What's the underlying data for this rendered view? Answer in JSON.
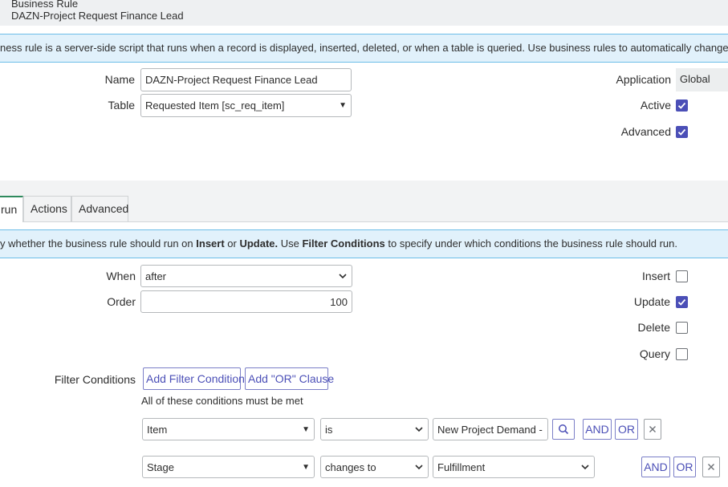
{
  "header": {
    "type_label": "Business Rule",
    "record_name": "DAZN-Project Request Finance Lead"
  },
  "info_banner": "ness rule is a server-side script that runs when a record is displayed, inserted, deleted, or when a table is queried. Use business rules to automatically change values in fo",
  "form": {
    "name_label": "Name",
    "name_value": "DAZN-Project Request Finance Lead",
    "table_label": "Table",
    "table_value": "Requested Item [sc_req_item]",
    "application_label": "Application",
    "application_value": "Global",
    "active_label": "Active",
    "active_checked": true,
    "advanced_label": "Advanced",
    "advanced_checked": true
  },
  "tabs": [
    {
      "label": "run",
      "active": true
    },
    {
      "label": "Actions",
      "active": false
    },
    {
      "label": "Advanced",
      "active": false
    }
  ],
  "when_banner": {
    "t1": "y whether the business rule should run on ",
    "b1": "Insert",
    "t2": " or ",
    "b2": "Update.",
    "t3": " Use ",
    "b3": "Filter Conditions",
    "t4": " to specify under which conditions the business rule should run."
  },
  "when": {
    "when_label": "When",
    "when_value": "after",
    "order_label": "Order",
    "order_value": "100",
    "insert_label": "Insert",
    "insert_checked": false,
    "update_label": "Update",
    "update_checked": true,
    "delete_label": "Delete",
    "delete_checked": false,
    "query_label": "Query",
    "query_checked": false
  },
  "filter": {
    "label": "Filter Conditions",
    "add_condition": "Add Filter Condition",
    "add_or": "Add \"OR\" Clause",
    "must_be_met": "All of these conditions must be met",
    "and_label": "AND",
    "or_label": "OR",
    "rows": [
      {
        "field": "Item",
        "operator": "is",
        "value": "New Project Demand - F"
      },
      {
        "field": "Stage",
        "operator": "changes to",
        "value": "Fulfillment"
      }
    ]
  },
  "colors": {
    "accent": "#4b4fb7",
    "info_bg": "#e1f1fb",
    "info_border": "#6cbde8",
    "tab_active_top": "#2f8a5d"
  }
}
